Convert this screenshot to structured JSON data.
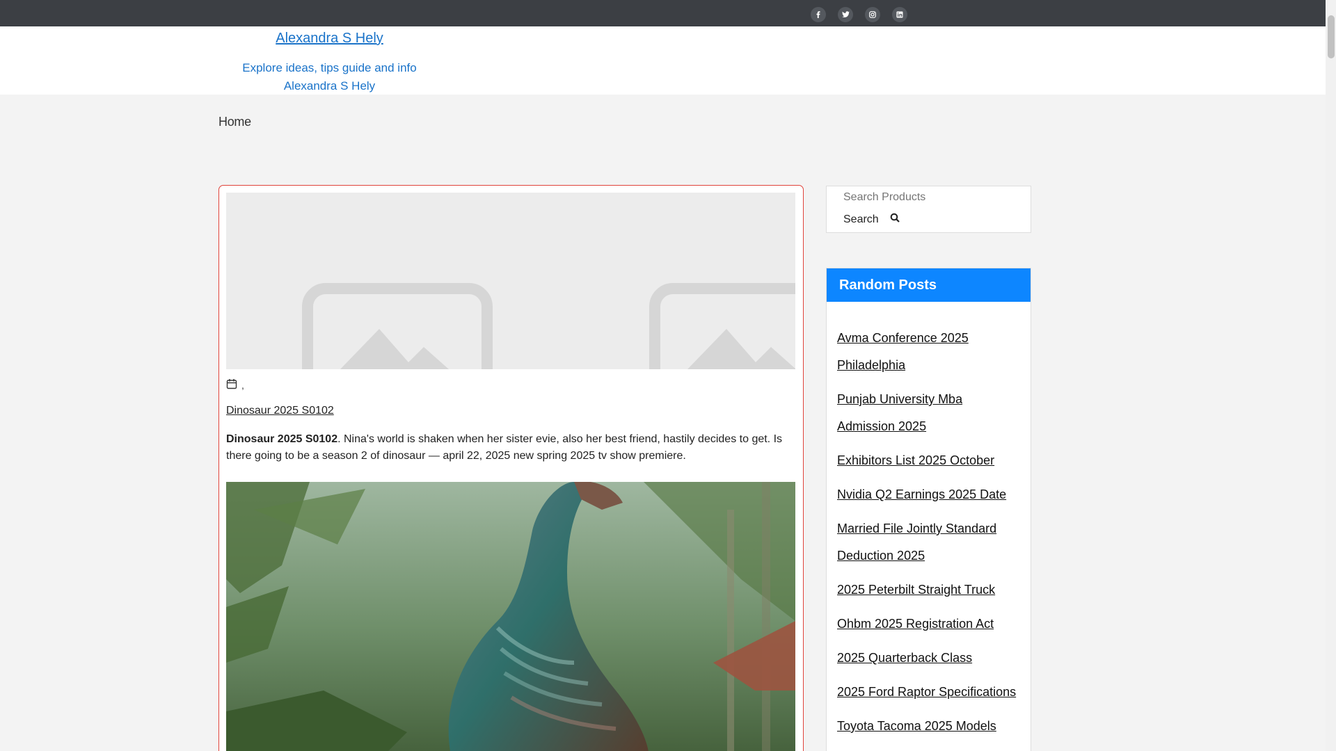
{
  "social": {
    "icons": [
      "facebook-icon",
      "twitter-icon",
      "instagram-icon",
      "linkedin-icon"
    ],
    "icon_bg": "#54585e"
  },
  "header": {
    "site_title": "Alexandra S Hely",
    "tagline": "Explore ideas, tips guide and info Alexandra S Hely",
    "accent": "#1a73c9"
  },
  "breadcrumb": {
    "home": "Home"
  },
  "post": {
    "meta_text": ",",
    "link_text": "Dinosaur 2025 S0102",
    "excerpt_bold": "Dinosaur 2025 S0102",
    "excerpt_text": ". Nina's world is shaken when her sister evie, also her best friend, hastily decides to get. Is there going to be a season 2 of dinosaur — april 22, 2025 new spring 2025 tv show premiere.",
    "card_border": "#e0433b"
  },
  "sidebar": {
    "search_placeholder": "Search Products",
    "search_label": "Search",
    "random_title": "Random Posts",
    "header_color": "#0d86ff",
    "random_posts": [
      "Avma Conference 2025 Philadelphia",
      "Punjab University Mba Admission 2025",
      "Exhibitors List 2025 October",
      "Nvidia Q2 Earnings 2025 Date",
      "Married File Jointly Standard Deduction 2025",
      "2025 Peterbilt Straight Truck",
      "Ohbm 2025 Registration Act",
      "2025 Quarterback Class",
      "2025 Ford Raptor Specifications",
      "Toyota Tacoma 2025 Models"
    ]
  }
}
